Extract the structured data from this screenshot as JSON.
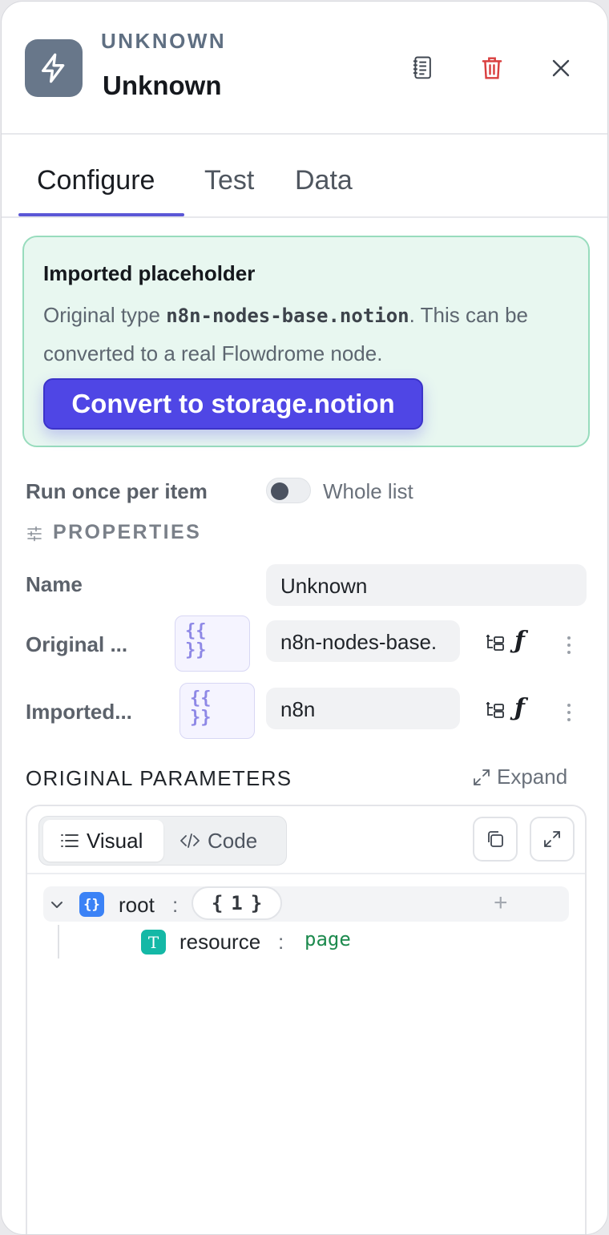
{
  "header": {
    "node_type": "UNKNOWN",
    "node_name": "Unknown",
    "icons": {
      "node": "lightning-icon",
      "notes": "notebook-icon",
      "delete": "trash-icon",
      "close": "close-icon"
    },
    "colors": {
      "node_icon_bg": "#68778a",
      "delete": "#d93f3f"
    }
  },
  "tabs": [
    {
      "label": "Configure",
      "active": true
    },
    {
      "label": "Test",
      "active": false
    },
    {
      "label": "Data",
      "active": false
    }
  ],
  "placeholder_notice": {
    "title": "Imported placeholder",
    "text_prefix": "Original type ",
    "original_type": "n8n-nodes-base.notion",
    "text_suffix": ". This can be converted to a real Flowdrome node.",
    "convert_button": "Convert to storage.notion",
    "colors": {
      "bg": "#e8f7f0",
      "border": "#98dcbd",
      "button": "#4f46e5"
    }
  },
  "run_mode": {
    "label": "Run once per item",
    "toggle_label": "Whole list",
    "toggle_on": false
  },
  "properties": {
    "section_label": "PROPERTIES",
    "icon": "sliders-icon",
    "fields": [
      {
        "label": "Name",
        "value": "Unknown"
      },
      {
        "label": "Original ...",
        "value": "n8n-nodes-base.",
        "expression_badge": "{{ }}"
      },
      {
        "label": "Imported...",
        "value": "n8n",
        "expression_badge": "{{ }}"
      }
    ]
  },
  "original_parameters": {
    "title": "ORIGINAL PARAMETERS",
    "expand_label": "Expand",
    "view_modes": [
      "Visual",
      "Code"
    ],
    "active_mode": "Visual",
    "tree": {
      "root_key": "root",
      "root_count": "1",
      "children": [
        {
          "key": "resource",
          "type": "T",
          "value": "page"
        }
      ]
    },
    "colors": {
      "object_badge": "#3b82f6",
      "text_badge": "#14b8a6",
      "string_value": "#1d8a4e"
    }
  }
}
